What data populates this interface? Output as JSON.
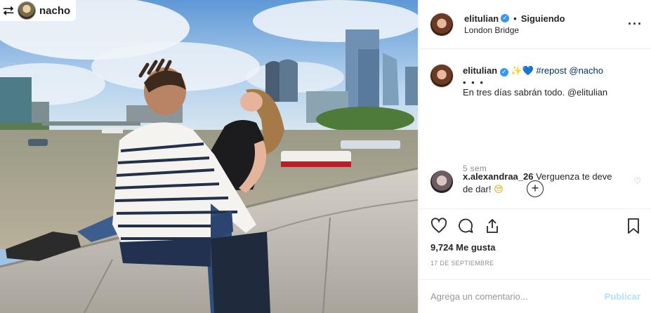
{
  "repost_tag": {
    "username": "nacho",
    "icon": "repost-icon"
  },
  "header": {
    "username": "elitulian",
    "verified_icon": "verified-badge-icon",
    "separator": "•",
    "follow_state": "Siguiendo",
    "location": "London Bridge",
    "more_icon": "more-options-icon"
  },
  "caption": {
    "username": "elitulian",
    "emojis": [
      "✨",
      "💙"
    ],
    "hashtag": "#repost",
    "mention": "@nacho",
    "more": "• • •",
    "text": "En tres días sabrán todo. @elitulian"
  },
  "time_ago": "5 sem",
  "load_more_icon": "plus-circle-icon",
  "comment": {
    "username": "x.alexandraa_26",
    "text": "Verguenza te deve de dar!",
    "emoji": "😒",
    "like_icon": "heart-outline-icon"
  },
  "actions": {
    "like": "heart-icon",
    "comment": "comment-icon",
    "share": "share-icon",
    "save": "bookmark-icon"
  },
  "likes_text": "9,724 Me gusta",
  "date_text": "17 DE SEPTIEMBRE",
  "comment_box": {
    "placeholder": "Agrega un comentario...",
    "publish_label": "Publicar"
  },
  "colors": {
    "link": "#003569",
    "verified": "#3897f0",
    "publish_disabled": "#b2dffc",
    "muted": "#8e8e8e"
  }
}
